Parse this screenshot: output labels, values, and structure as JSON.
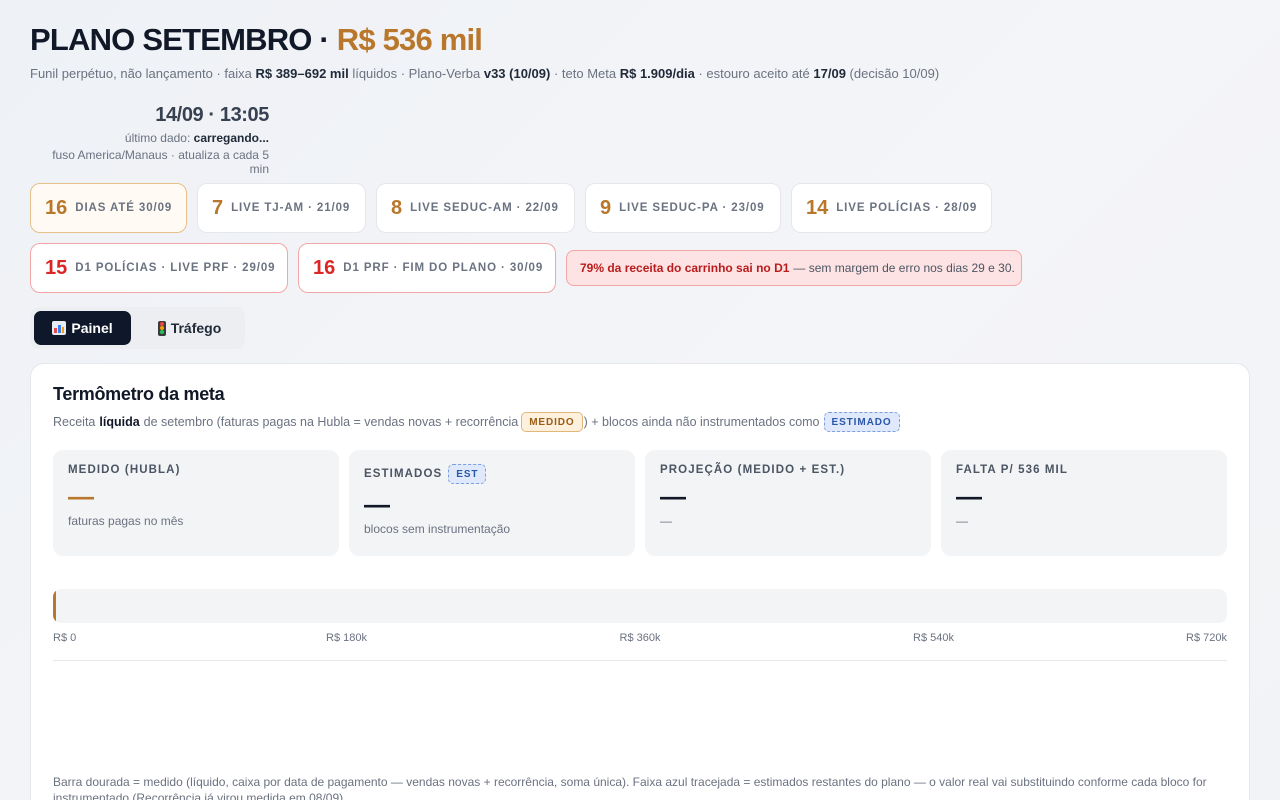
{
  "header": {
    "title_main": "PLANO SETEMBRO",
    "title_sep": " · ",
    "title_amount": "R$ 536 mil",
    "subtitle": {
      "p1": "Funil perpétuo, não lançamento · faixa ",
      "b1": "R$ 389–692 mil",
      "p2": " líquidos · Plano-Verba ",
      "b2": "v33 (10/09)",
      "p3": " · teto Meta ",
      "b3": "R$ 1.909/dia",
      "p4": " · estouro aceito até ",
      "b4": "17/09",
      "p5": " (decisão 10/09)"
    }
  },
  "clock": {
    "time": "14/09 · 13:05",
    "last_label": "último dado: ",
    "last_value": "carregando...",
    "tz": "fuso America/Manaus · atualiza a cada 5 min"
  },
  "countdowns": [
    {
      "num": "16",
      "label": "DIAS ATÉ 30/09"
    },
    {
      "num": "7",
      "label": "LIVE TJ-AM · 21/09"
    },
    {
      "num": "8",
      "label": "LIVE SEDUC-AM · 22/09"
    },
    {
      "num": "9",
      "label": "LIVE SEDUC-PA · 23/09"
    },
    {
      "num": "14",
      "label": "LIVE POLÍCIAS · 28/09"
    },
    {
      "num": "15",
      "label": "D1 POLÍCIAS · LIVE PRF · 29/09"
    },
    {
      "num": "16",
      "label": "D1 PRF · FIM DO PLANO · 30/09"
    }
  ],
  "alert": {
    "strong": "79% da receita do carrinho sai no D1",
    "rest": "— sem margem de erro nos dias 29 e 30."
  },
  "tabs": [
    {
      "label": "Painel",
      "icon": "bar-chart-icon",
      "active": true
    },
    {
      "label": "Tráfego",
      "icon": "traffic-light-icon",
      "active": false
    }
  ],
  "thermometer": {
    "title": "Termômetro da meta",
    "desc_p1": "Receita",
    "desc_b": "líquida",
    "desc_p2": "de setembro (faturas pagas na Hubla = vendas novas + recorrência",
    "badge_medido": "MEDIDO",
    "desc_p3": ") + blocos ainda não instrumentados como",
    "badge_estimado": "ESTIMADO",
    "stats": [
      {
        "label": "MEDIDO (HUBLA)",
        "value": "—",
        "sub": "faturas pagas no mês"
      },
      {
        "label": "ESTIMADOS",
        "badge": "EST",
        "value": "—",
        "sub": "blocos sem instrumentação"
      },
      {
        "label": "PROJEÇÃO (MEDIDO + EST.)",
        "value": "—",
        "sub": "—"
      },
      {
        "label": "FALTA P/ 536 MIL",
        "value": "—",
        "sub": "—"
      }
    ],
    "progress_fraction": 0,
    "scale_labels": [
      "R$ 0",
      "R$ 180k",
      "R$ 360k",
      "R$ 540k",
      "R$ 720k"
    ],
    "note": "Barra dourada = medido (líquido, caixa por data de pagamento — vendas novas + recorrência, soma única). Faixa azul tracejada = estimados restantes do plano — o valor real vai substituindo conforme cada bloco for instrumentado (Recorrência já virou medida em 08/09)."
  },
  "colors": {
    "accent_gold": "#b8772a",
    "alert_red": "#dc2626",
    "tab_active": "#0f172a",
    "est_blue": "#2b57a8"
  }
}
